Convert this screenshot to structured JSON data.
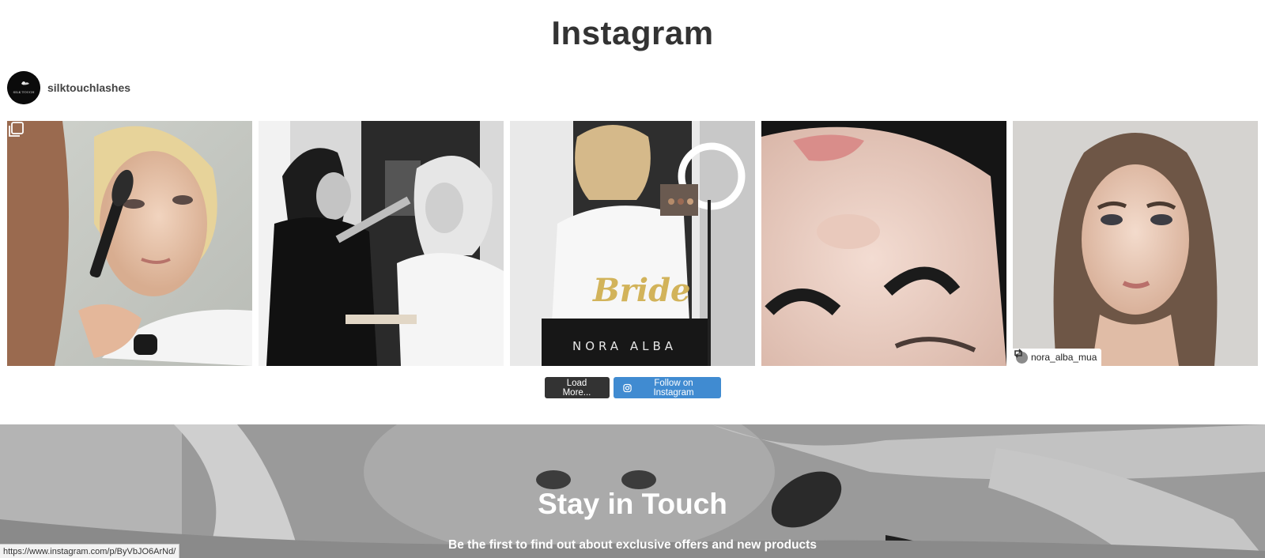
{
  "instagram": {
    "title": "Instagram",
    "username": "silktouchlashes",
    "avatar_text": "SILK TOUCH",
    "posts": [
      {
        "icon": "carousel-icon"
      },
      {},
      {
        "overlay_text": "Bride",
        "chair_text": "NORA ALBA"
      },
      {},
      {
        "repost_user": "nora_alba_mua",
        "icon": "repost-icon"
      }
    ],
    "load_more_label": "Load More...",
    "follow_label": "Follow on Instagram"
  },
  "stay_in_touch": {
    "title": "Stay in Touch",
    "subtitle": "Be the first to find out about exclusive offers and new products"
  },
  "status_bar": {
    "url": "https://www.instagram.com/p/ByVbJO6ArNd/"
  },
  "colors": {
    "load_button": "#333333",
    "follow_button": "#408bd1",
    "title_text": "#333333"
  }
}
